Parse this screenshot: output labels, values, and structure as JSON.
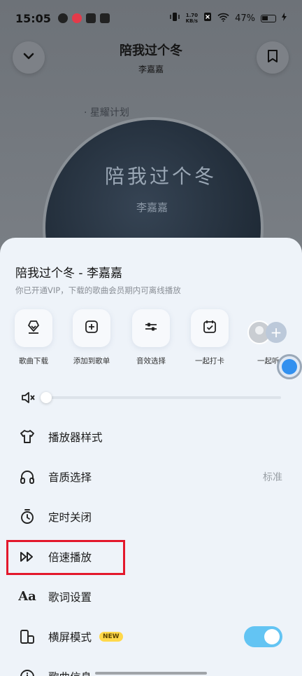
{
  "status": {
    "time": "15:05",
    "net_speed_top": "1.70",
    "net_speed_bottom": "KB/s",
    "battery": "47%"
  },
  "player": {
    "song_title": "陪我过个冬",
    "artist": "李嘉嘉",
    "album_tag": "· 星耀计划",
    "disc_title": "陪我过个冬",
    "disc_sign": "李嘉嘉"
  },
  "sheet": {
    "title": "陪我过个冬 - 李嘉嘉",
    "subtitle": "你已开通VIP，下载的歌曲会员期内可离线播放",
    "quick_actions": [
      {
        "label": "歌曲下载",
        "icon": "download-icon"
      },
      {
        "label": "添加到歌单",
        "icon": "add-to-playlist-icon"
      },
      {
        "label": "音效选择",
        "icon": "equalizer-icon"
      },
      {
        "label": "一起打卡",
        "icon": "checkin-icon"
      },
      {
        "label": "一起听",
        "icon": "listen-together-icon"
      }
    ],
    "menu": [
      {
        "label": "播放器样式",
        "icon": "shirt-icon"
      },
      {
        "label": "音质选择",
        "icon": "headphones-icon",
        "value": "标准"
      },
      {
        "label": "定时关闭",
        "icon": "timer-icon"
      },
      {
        "label": "倍速播放",
        "icon": "fast-forward-icon"
      },
      {
        "label": "歌词设置",
        "icon": "lyrics-icon"
      },
      {
        "label": "横屏模式",
        "icon": "landscape-icon",
        "badge": "NEW",
        "toggle_on": true
      },
      {
        "label": "歌曲信息",
        "icon": "info-icon"
      }
    ],
    "volume_level": 0.0
  },
  "colors": {
    "highlight": "#e3182c",
    "toggle_on": "#63c4f3",
    "accent_blue": "#3290ef"
  }
}
